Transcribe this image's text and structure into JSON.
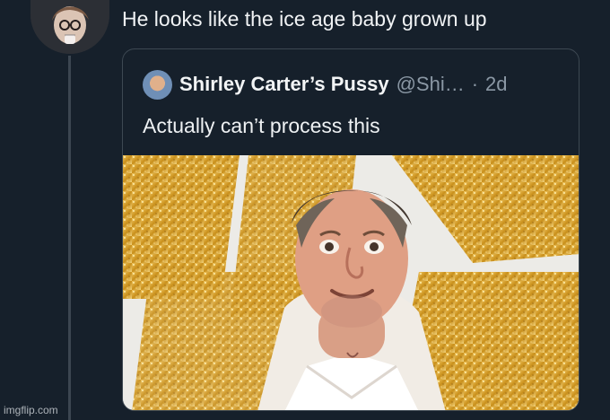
{
  "tweet": {
    "text": "He looks like the ice age baby grown up"
  },
  "quoted_tweet": {
    "display_name": "Shirley Carter’s Pussy",
    "handle": "@Shi…",
    "time_separator": "·",
    "timestamp": "2d",
    "text": "Actually can’t process this"
  },
  "watermark": "imgflip.com"
}
